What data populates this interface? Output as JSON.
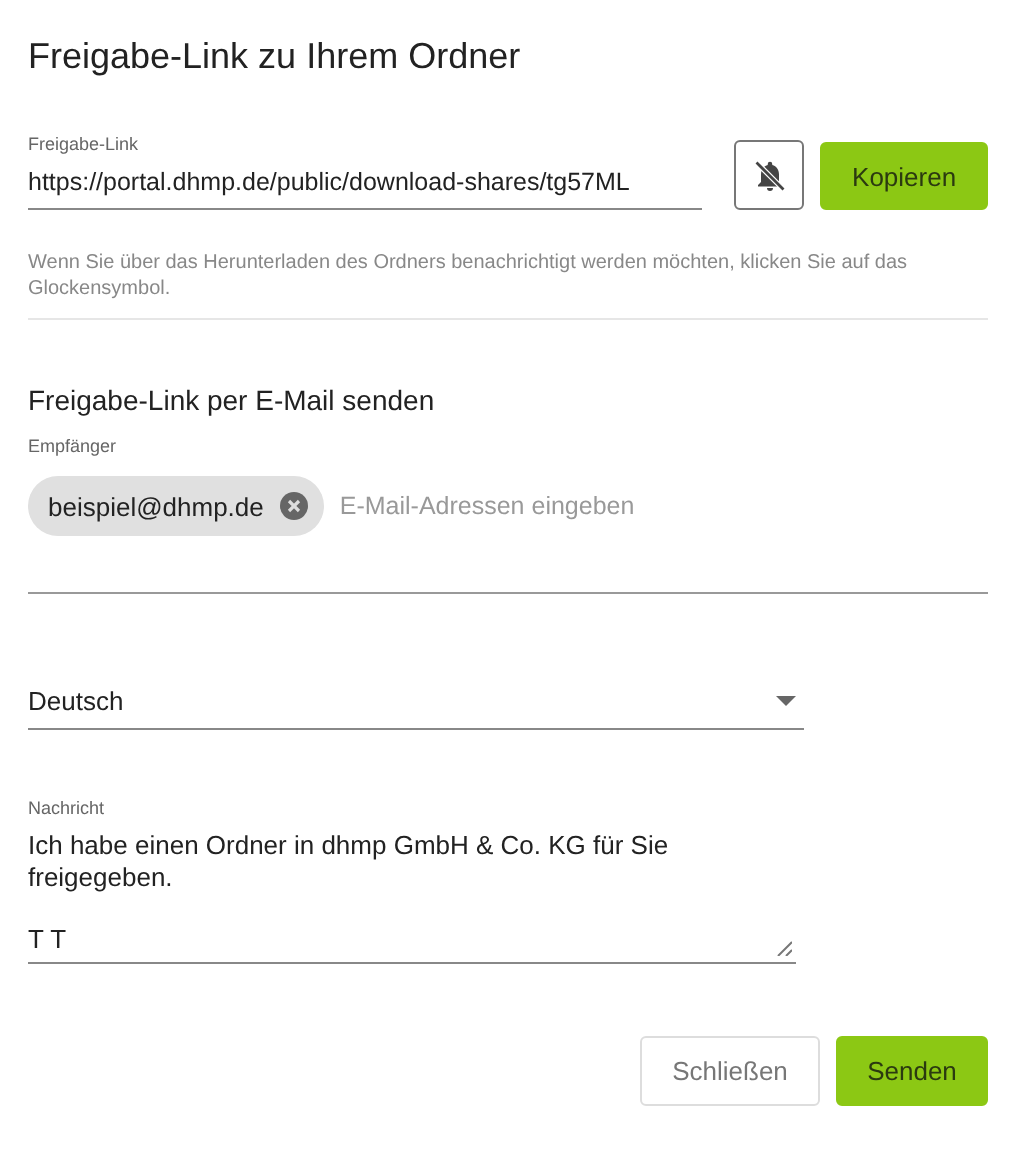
{
  "dialog": {
    "title": "Freigabe-Link zu Ihrem Ordner"
  },
  "share_link": {
    "label": "Freigabe-Link",
    "value": "https://portal.dhmp.de/public/download-shares/tg57ML",
    "notify": false,
    "copy_button": "Kopieren"
  },
  "hint": "Wenn Sie über das Herunterladen des Ordners benachrichtigt werden möchten, klicken Sie auf das Glockensymbol.",
  "email": {
    "title": "Freigabe-Link per E-Mail senden",
    "recipients_label": "Empfänger",
    "recipients": [
      {
        "address": "beispiel@dhmp.de"
      }
    ],
    "recipients_placeholder": "E-Mail-Adressen eingeben",
    "language": "Deutsch",
    "message_label": "Nachricht",
    "message": "Ich habe einen Ordner in dhmp GmbH & Co. KG für Sie freigegeben.\n\nT T"
  },
  "buttons": [
    {
      "label": "Schließen",
      "kind": "secondary"
    },
    {
      "label": "Senden",
      "kind": "primary"
    }
  ]
}
